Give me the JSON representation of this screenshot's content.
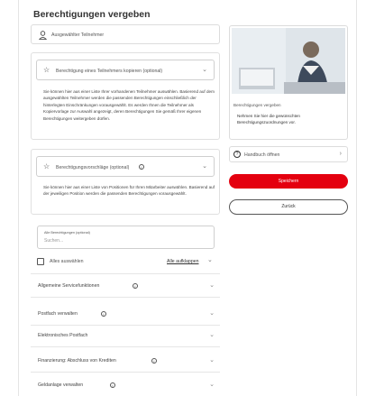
{
  "page": {
    "title": "Berechtigungen vergeben"
  },
  "participant": {
    "label": "Ausgewählter Teilnehmer"
  },
  "copy_section": {
    "title": "Berechtigung eines Teilnehmers kopieren (optional)",
    "description": "Sie können hier aus einer Liste Ihrer vorhandenen Teilnehmer auswählen. Basierend auf dem ausgewählten Teilnehmer werden die passenden Berechtigungen einschließlich der hinterlegten Einschränkungen vorausgewählt. Es werden Ihnen die Teilnehmer als Kopiervorlage zur Auswahl angezeigt, deren Berechtigungen Sie gemäß Ihrer eigenen Berechtigungen weitergeben dürfen."
  },
  "suggestions_section": {
    "title": "Berechtigungsvorschläge (optional)",
    "description": "Sie können hier aus einer Liste von Positionen für Ihren Mitarbeiter auswählen. Basierend auf der jeweiligen Position werden die passenden Berechtigungen vorausgewählt."
  },
  "search": {
    "label": "Alle Berechtigungen (optional)",
    "placeholder": "Suchen..."
  },
  "select_all": {
    "label": "Alles auswählen",
    "expand_all": "Alle aufklappen"
  },
  "categories": [
    {
      "label": "Allgemeine Servicefunktionen"
    },
    {
      "label": "Postfach verwalten"
    },
    {
      "label": "Elektronisches Postfach"
    },
    {
      "label": "Finanzierung: Abschluss von Krediten"
    },
    {
      "label": "Geldanlage verwalten"
    }
  ],
  "sidebar": {
    "image_caption": "Berechtigungen vergeben",
    "info_text": "Nehmen Sie hier die gewünschten Berechtigungszuordnungen vor.",
    "manual_link": "Handbuch öffnen",
    "save_button": "Speichern",
    "back_button": "Zurück"
  },
  "colors": {
    "primary": "#e4000f",
    "border": "#dcdcdc",
    "text": "#333333"
  }
}
